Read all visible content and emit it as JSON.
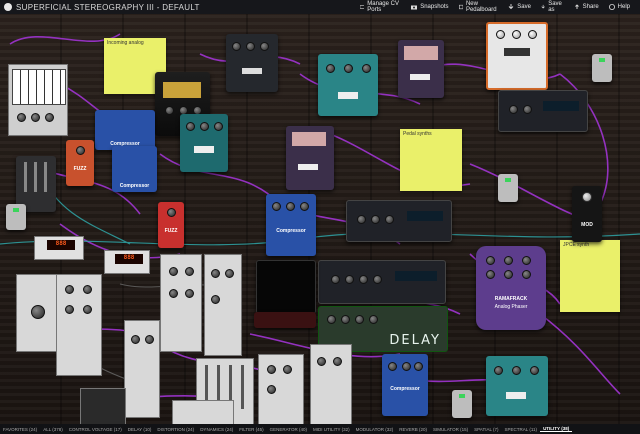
{
  "app": {
    "title": "SUPERFICIAL STEREOGRAPHY III - DEFAULT"
  },
  "toolbar": {
    "manage_cv": "Manage CV Ports",
    "snapshots": "Snapshots",
    "new_pedalboard": "New Pedalboard",
    "save": "Save",
    "save_as": "Save as",
    "share": "Share",
    "help": "Help"
  },
  "notes": {
    "top_left": "Incoming analog",
    "middle_right": "Pedal synths",
    "bottom_right": "JPCE synth"
  },
  "pedals": {
    "compressor_a": "Compressor",
    "compressor_b": "Compressor",
    "compressor_c": "Compressor",
    "compressor_d": "Compressor",
    "fuzz_a": "FUZZ",
    "fuzz_b": "FUZZ",
    "mod": "MOD",
    "big_muff_title": "RAMAFRACK",
    "big_muff_sub": "Analog Phaser",
    "delay": "DELAY"
  },
  "tabs": [
    "FAVORITES (24)",
    "ALL (378)",
    "CONTROL VOLTAGE (17)",
    "DELAY (10)",
    "DISTORTION (24)",
    "DYNAMICS (24)",
    "FILTER (45)",
    "GENERATOR (40)",
    "MIDI UTILITY (32)",
    "MODULATOR (32)",
    "REVERB (20)",
    "SIMULATOR (15)",
    "SPATIAL (7)",
    "SPECTRAL (11)",
    "UTILITY (38)"
  ],
  "active_tab": "UTILITY (38)",
  "colors": {
    "cable": "#9a33c9",
    "cable_teal": "#2fa6a8",
    "note": "#eaf06a"
  }
}
